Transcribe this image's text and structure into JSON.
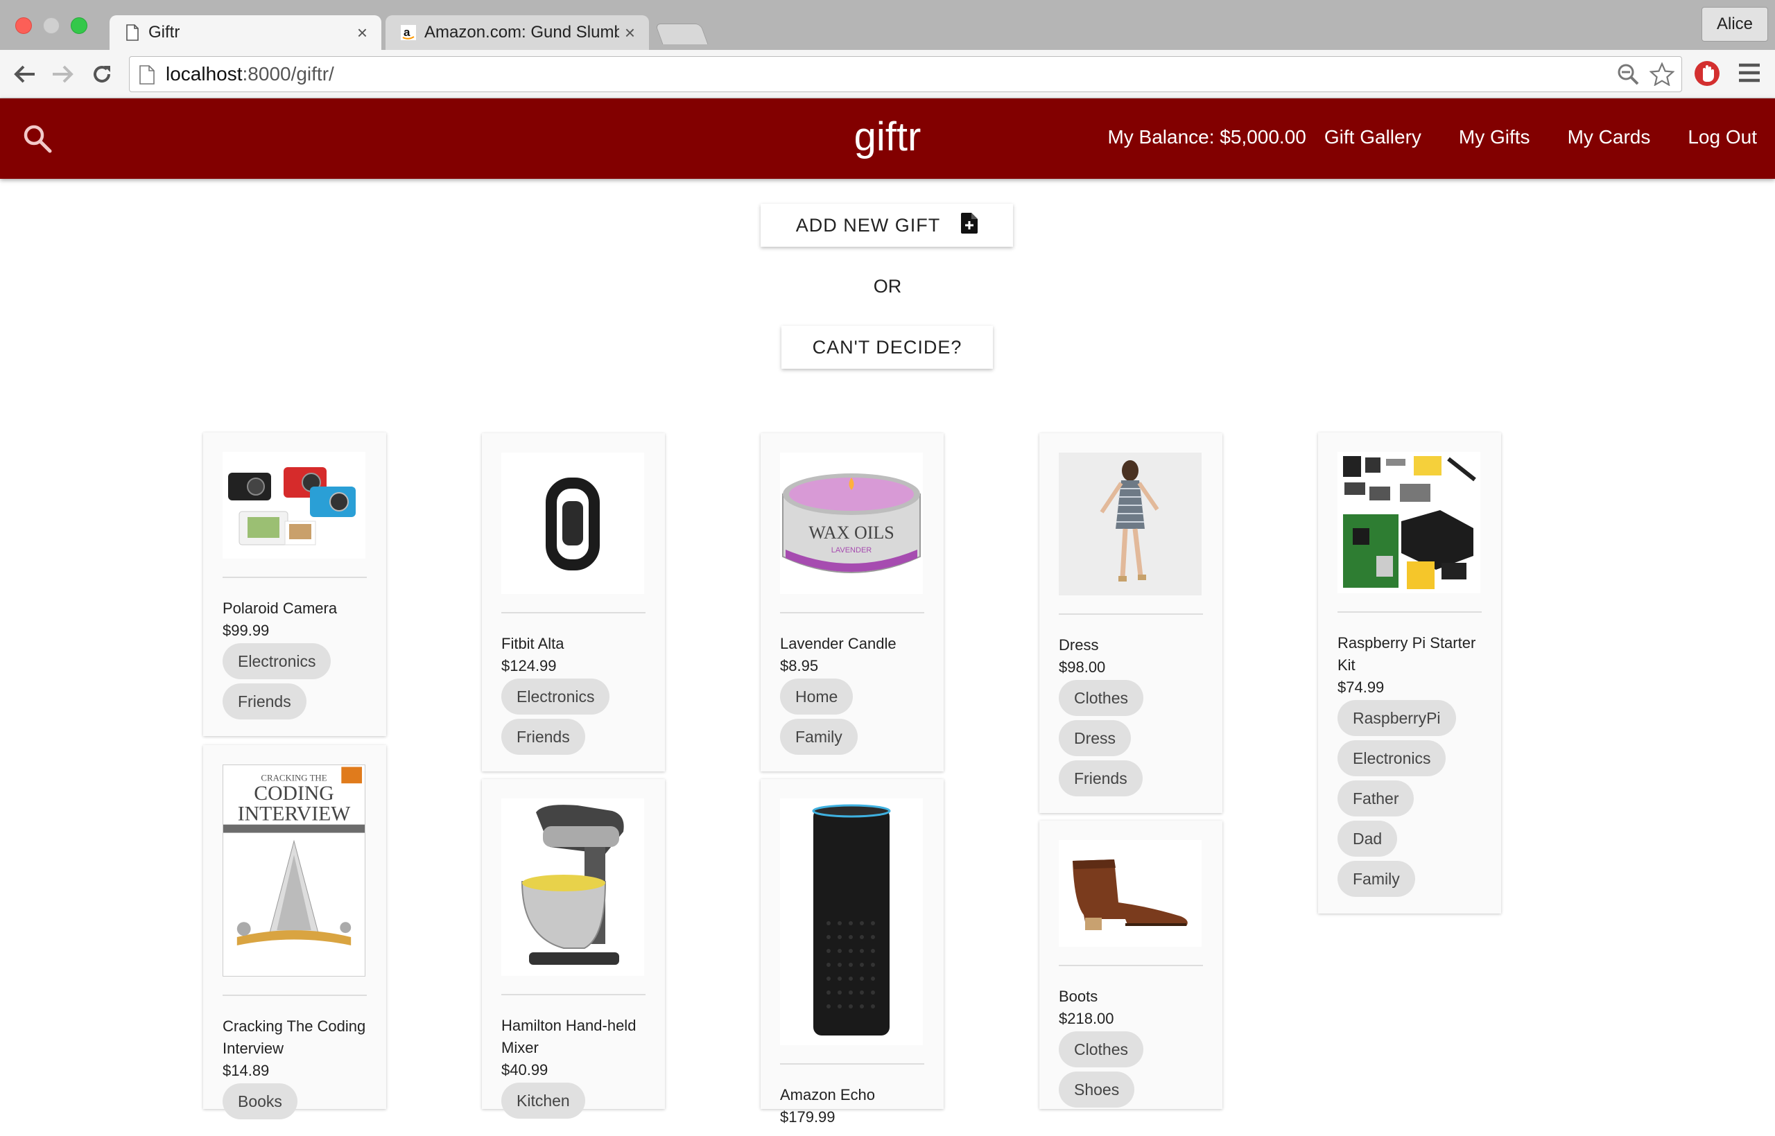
{
  "browser": {
    "tabs": [
      {
        "title": "Giftr",
        "close": "×"
      },
      {
        "title": "Amazon.com: Gund Slumb",
        "close": "×"
      }
    ],
    "profile": "Alice",
    "url_host": "localhost",
    "url_rest": ":8000/giftr/"
  },
  "header": {
    "brand": "giftr",
    "balance": "My Balance: $5,000.00",
    "nav": [
      "Gift Gallery",
      "My Gifts",
      "My Cards",
      "Log Out"
    ]
  },
  "actions": {
    "add_gift": "ADD NEW GIFT",
    "or": "OR",
    "cant_decide": "CAN'T DECIDE?"
  },
  "gifts": [
    {
      "name": "Polaroid Camera",
      "price": "$99.99",
      "tags": [
        "Electronics",
        "Friends"
      ]
    },
    {
      "name": "Cracking The Coding Interview",
      "price": "$14.89",
      "tags": [
        "Books"
      ]
    },
    {
      "name": "Fitbit Alta",
      "price": "$124.99",
      "tags": [
        "Electronics",
        "Friends"
      ]
    },
    {
      "name": "Hamilton Hand-held Mixer",
      "price": "$40.99",
      "tags": [
        "Kitchen"
      ]
    },
    {
      "name": "Lavender Candle",
      "price": "$8.95",
      "tags": [
        "Home",
        "Family"
      ]
    },
    {
      "name": "Amazon Echo",
      "price": "$179.99",
      "tags": []
    },
    {
      "name": "Dress",
      "price": "$98.00",
      "tags": [
        "Clothes",
        "Dress",
        "Friends"
      ]
    },
    {
      "name": "Boots",
      "price": "$218.00",
      "tags": [
        "Clothes",
        "Shoes"
      ]
    },
    {
      "name": "Raspberry Pi Starter Kit",
      "price": "$74.99",
      "tags": [
        "RaspberryPi",
        "Electronics",
        "Father",
        "Dad",
        "Family"
      ]
    }
  ],
  "images": {
    "book_top": "CRACKING THE",
    "book_title1": "CODING",
    "book_title2": "INTERVIEW",
    "candle_brand": "WAX OILS",
    "candle_scent": "LAVENDER"
  },
  "colors": {
    "header": "#820000",
    "tag": "#e0e0e0"
  }
}
